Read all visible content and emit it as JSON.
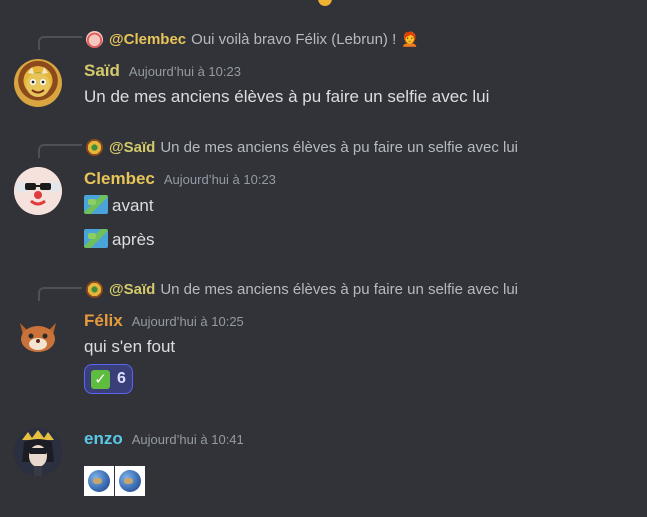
{
  "messages": [
    {
      "reply": {
        "mention": "@Clembec",
        "text": "Oui voilà bravo Félix (Lebrun) !",
        "emoji": "🧑‍🦰"
      },
      "author": "Saïd",
      "author_color": "#d4c96b",
      "timestamp": "Aujourd’hui à 10:23",
      "lines": [
        "Un de mes anciens élèves à pu faire un selfie avec lui"
      ]
    },
    {
      "reply": {
        "mention": "@Saïd",
        "text": "Un de mes anciens élèves à pu faire un selfie avec lui"
      },
      "author": "Clembec",
      "author_color": "#e8c45a",
      "timestamp": "Aujourd’hui à 10:23",
      "lines": [
        "avant",
        "après"
      ],
      "line_icons": [
        "map-emoji",
        "map-emoji"
      ]
    },
    {
      "reply": {
        "mention": "@Saïd",
        "text": "Un de mes anciens élèves à pu faire un selfie avec lui"
      },
      "author": "Félix",
      "author_color": "#e89b3c",
      "timestamp": "Aujourd’hui à 10:25",
      "lines": [
        "qui s'en fout"
      ],
      "reaction": {
        "emoji": "✅",
        "count": "6"
      }
    },
    {
      "author": "enzo",
      "author_color": "#5bc8e8",
      "timestamp": "Aujourd’hui à 10:41",
      "attachments": [
        "globe-emoji",
        "globe-emoji"
      ]
    }
  ],
  "colors": {
    "background": "#313338",
    "text": "#dbdee1",
    "muted": "#949ba4",
    "reaction_bg": "#3b3f79",
    "reaction_border": "#5865f2"
  }
}
